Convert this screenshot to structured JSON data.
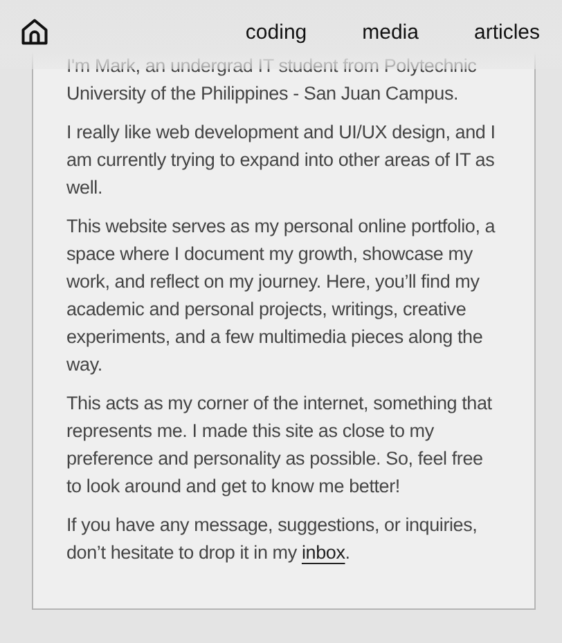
{
  "nav": {
    "links": [
      {
        "label": "coding"
      },
      {
        "label": "media"
      },
      {
        "label": "articles"
      }
    ]
  },
  "about": {
    "paragraphs": [
      {
        "text": "I'm Mark, an undergrad IT student from Polytechnic University of the Philippines - San Juan Campus."
      },
      {
        "text": "I really like web development and UI/UX design, and I am currently trying to expand into other areas of IT as well."
      },
      {
        "text": "This website serves as my personal online portfolio, a space where I document my growth, showcase my work, and reflect on my journey. Here, you’ll find my academic and personal projects, writings, creative experiments, and a few multimedia pieces along the way."
      },
      {
        "text": "This acts as my corner of the internet, something that represents me. I made this site as close to my preference and personality as possible. So, feel free to look around and get to know me better!"
      },
      {
        "text": "If you have any message, suggestions, or inquiries, don’t hesitate to drop it in my",
        "link": "inbox",
        "after": "."
      }
    ]
  }
}
